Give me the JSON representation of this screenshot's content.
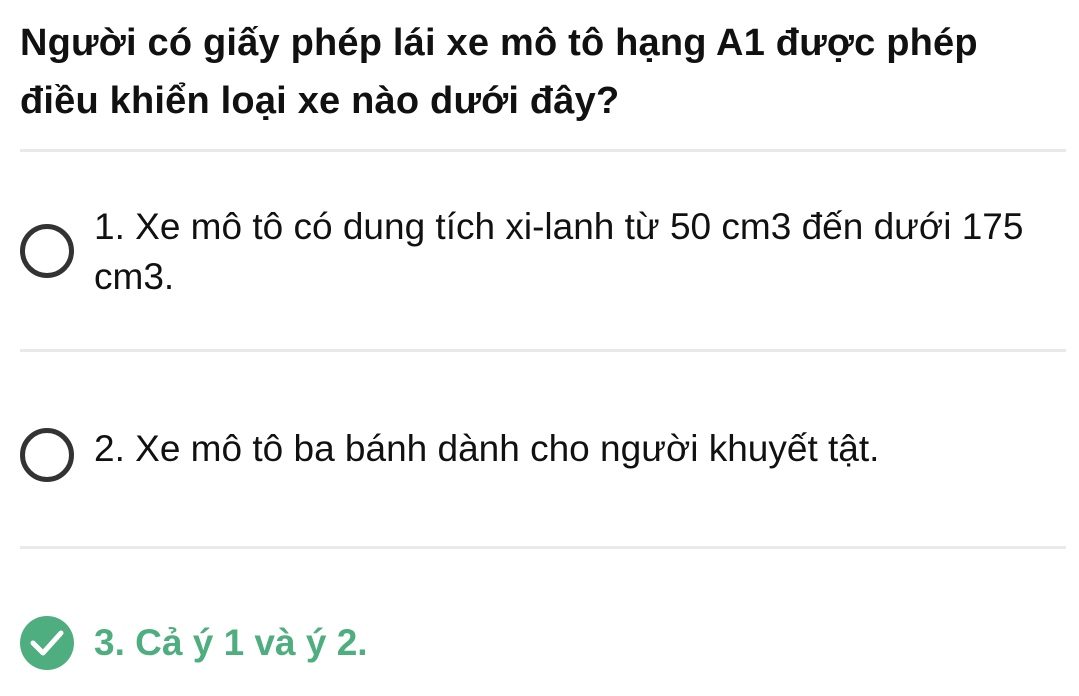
{
  "question": {
    "text": "Người có giấy phép lái xe mô tô hạng A1 được phép điều khiển loại xe nào dưới đây?"
  },
  "options": [
    {
      "text": "1. Xe mô tô có dung tích xi-lanh từ 50 cm3 đến dưới 175 cm3.",
      "state": "unselected"
    },
    {
      "text": "2. Xe mô tô ba bánh dành cho người khuyết tật.",
      "state": "unselected"
    },
    {
      "text": "3. Cả ý 1 và ý 2.",
      "state": "correct"
    }
  ],
  "colors": {
    "correct": "#4fae7f",
    "radio_border": "#333333",
    "divider": "#e9e9e9",
    "text": "#111111"
  },
  "icons": {
    "unselected": "radio-empty-icon",
    "correct": "check-circle-icon"
  }
}
